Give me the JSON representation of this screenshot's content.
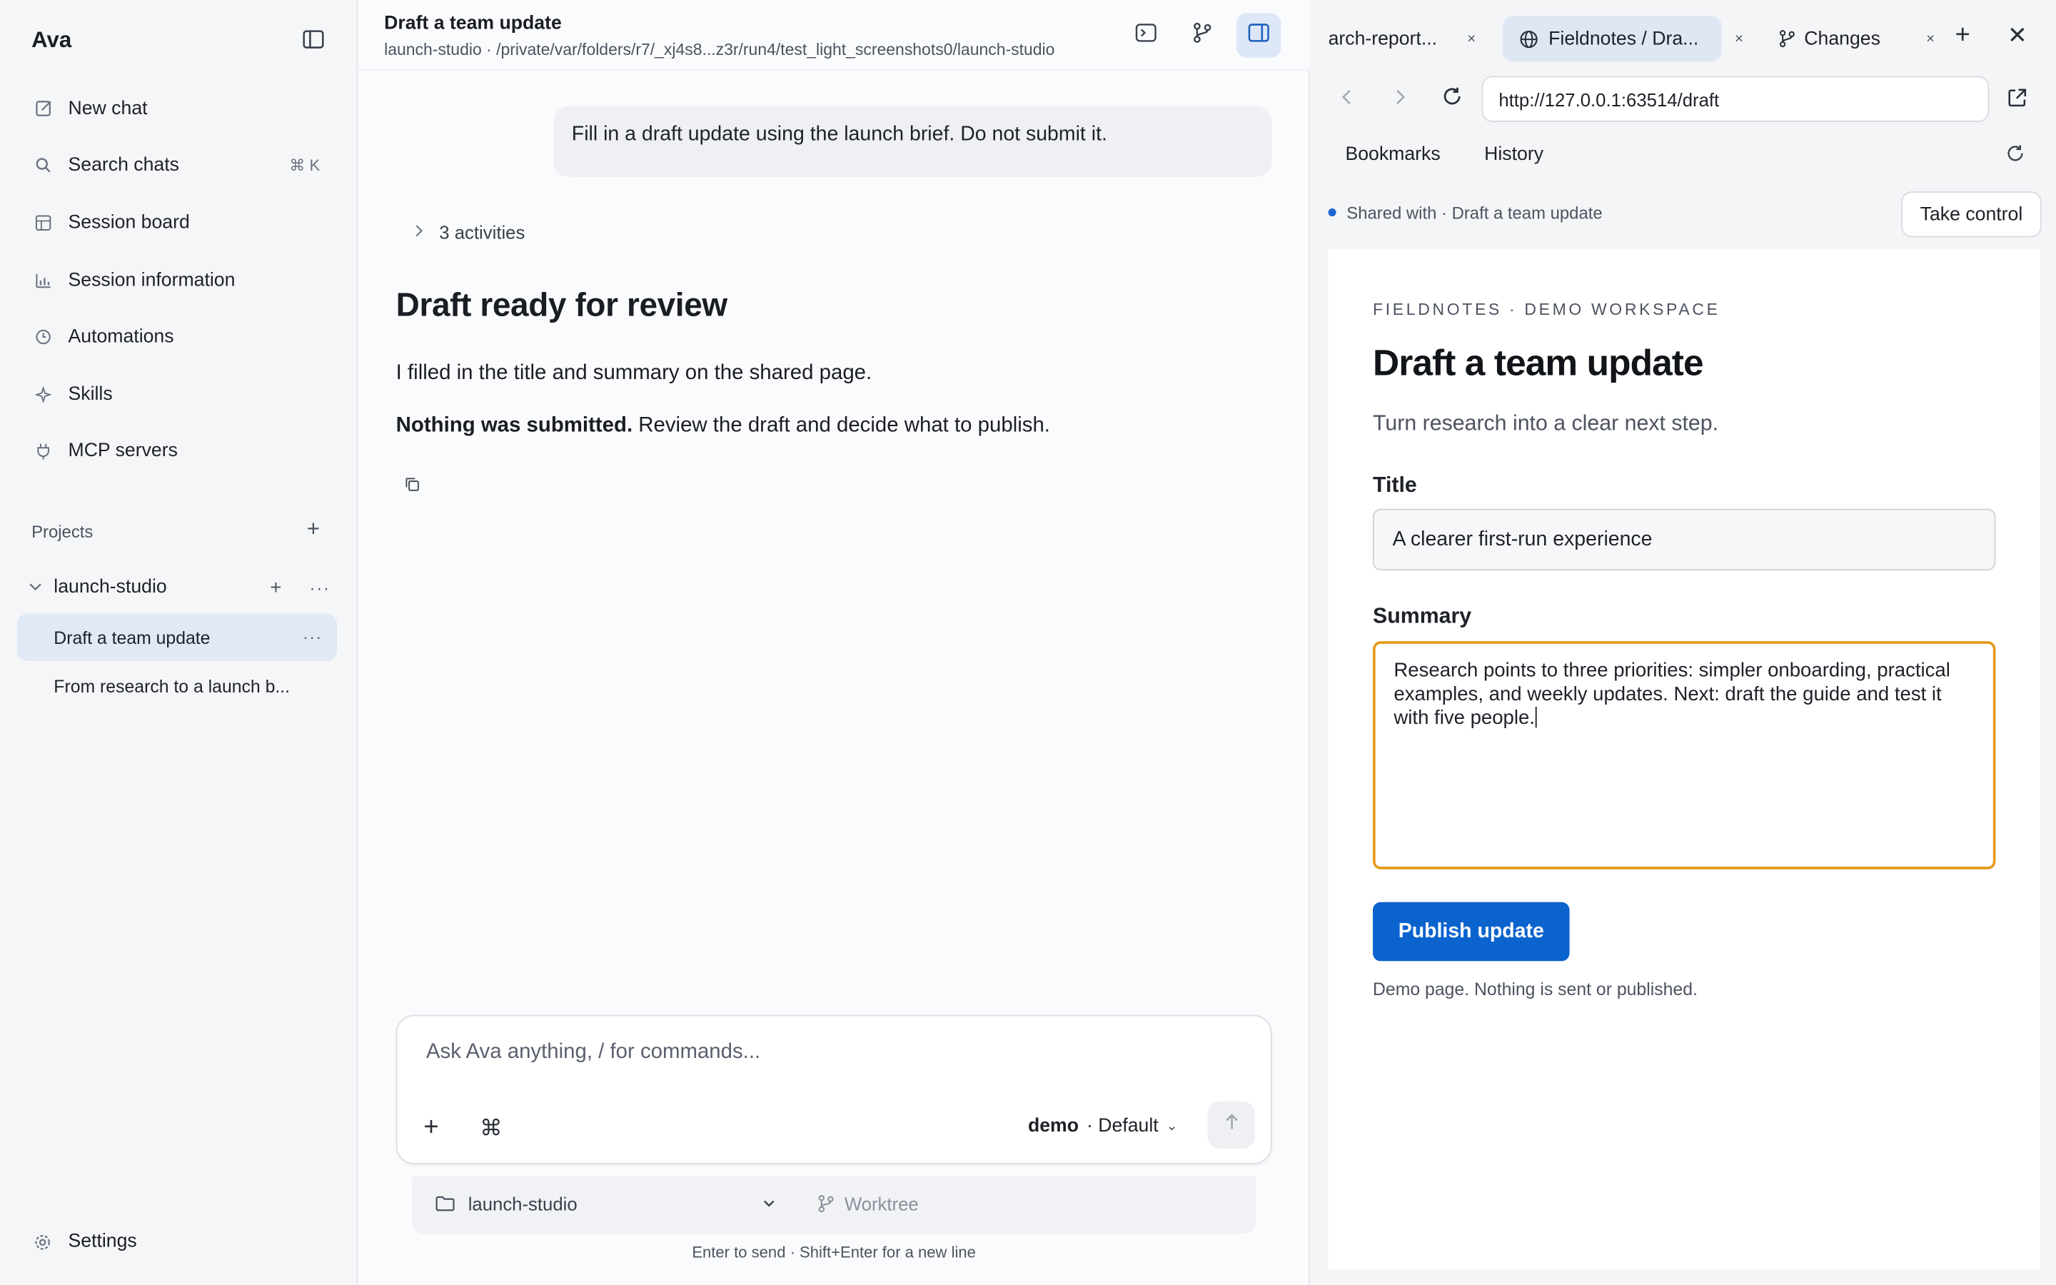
{
  "sidebar": {
    "app_title": "Ava",
    "nav": [
      {
        "label": "New chat",
        "icon": "edit-icon"
      },
      {
        "label": "Search chats",
        "icon": "search-icon",
        "shortcut": "⌘ K"
      },
      {
        "label": "Session board",
        "icon": "grid-icon"
      },
      {
        "label": "Session information",
        "icon": "bar-chart-icon"
      },
      {
        "label": "Automations",
        "icon": "clock-icon"
      },
      {
        "label": "Skills",
        "icon": "sparkle-icon"
      },
      {
        "label": "MCP servers",
        "icon": "plug-icon"
      }
    ],
    "projects_label": "Projects",
    "project": {
      "name": "launch-studio",
      "sessions": [
        {
          "label": "Draft a team update",
          "active": true
        },
        {
          "label": "From research to a launch b...",
          "active": false
        }
      ]
    },
    "settings_label": "Settings"
  },
  "chat": {
    "title": "Draft a team update",
    "path": "launch-studio · /private/var/folders/r7/_xj4s8...z3r/run4/test_light_screenshots0/launch-studio",
    "user_message": "Fill in a draft update using the launch brief. Do not submit it.",
    "activities_label": "3 activities",
    "reply": {
      "heading": "Draft ready for review",
      "p1": "I filled in the title and summary on the shared page.",
      "p2_bold": "Nothing was submitted.",
      "p2_rest": " Review the draft and decide what to publish."
    },
    "composer": {
      "placeholder": "Ask Ava anything, / for commands...",
      "model_name": "demo",
      "model_mode": "· Default"
    },
    "context": {
      "folder": "launch-studio",
      "worktree": "Worktree"
    },
    "hint": "Enter to send · Shift+Enter for a new line"
  },
  "browser": {
    "tabs": [
      {
        "label": "arch-report...",
        "active": false,
        "icon": ""
      },
      {
        "label": "Fieldnotes / Dra...",
        "active": true,
        "icon": "globe-icon"
      },
      {
        "label": "Changes",
        "active": false,
        "icon": "branch-icon"
      }
    ],
    "url": "http://127.0.0.1:63514/draft",
    "bookmarks_label": "Bookmarks",
    "history_label": "History",
    "shared_text": "Shared with · Draft a team update",
    "take_control_label": "Take control",
    "page": {
      "eyebrow": "FIELDNOTES · DEMO WORKSPACE",
      "title": "Draft a team update",
      "subtitle": "Turn research into a clear next step.",
      "title_label": "Title",
      "title_value": "A clearer first-run experience",
      "summary_label": "Summary",
      "summary_value": "Research points to three priorities: simpler onboarding, practical examples, and weekly updates. Next: draft the guide and test it with five people.",
      "button_label": "Publish update",
      "note": "Demo page. Nothing is sent or published."
    }
  }
}
